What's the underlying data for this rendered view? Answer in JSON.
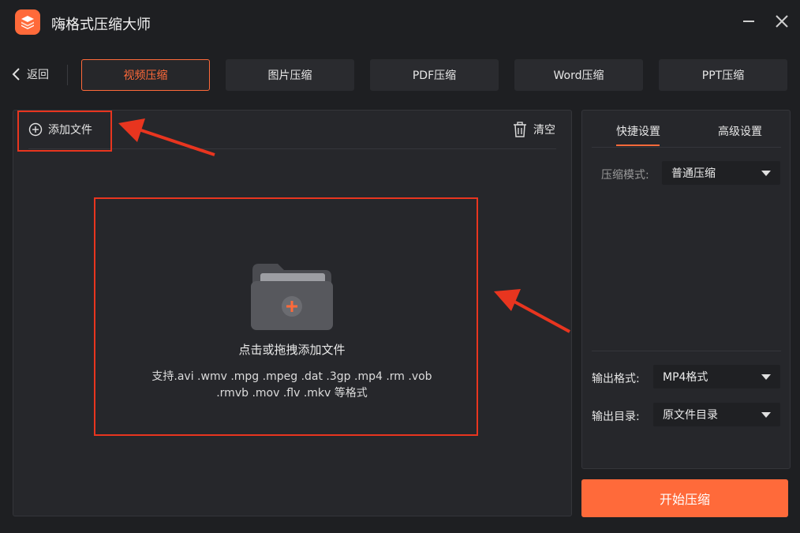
{
  "app": {
    "title": "嗨格式压缩大师",
    "accent": "#ff6a3a",
    "annotation_color": "#e8351f"
  },
  "nav": {
    "back_label": "返回",
    "tabs": [
      {
        "label": "视频压缩",
        "active": true
      },
      {
        "label": "图片压缩",
        "active": false
      },
      {
        "label": "PDF压缩",
        "active": false
      },
      {
        "label": "Word压缩",
        "active": false
      },
      {
        "label": "PPT压缩",
        "active": false
      }
    ]
  },
  "file_panel": {
    "add_file_label": "添加文件",
    "clear_label": "清空",
    "drop_hint": "点击或拖拽添加文件",
    "formats_line1": "支持.avi .wmv .mpg .mpeg .dat .3gp .mp4 .rm .vob",
    "formats_line2": ".rmvb .mov .flv .mkv 等格式"
  },
  "settings": {
    "tabs": [
      {
        "label": "快捷设置",
        "active": true
      },
      {
        "label": "高级设置",
        "active": false
      }
    ],
    "mode_label": "压缩模式:",
    "mode_value": "普通压缩",
    "output_format_label": "输出格式:",
    "output_format_value": "MP4格式",
    "output_dir_label": "输出目录:",
    "output_dir_value": "原文件目录"
  },
  "start_button": "开始压缩",
  "icons": [
    "app-logo-icon",
    "minimize-icon",
    "close-icon",
    "chevron-left-icon",
    "plus-circle-icon",
    "trash-icon",
    "folder-plus-icon",
    "caret-down-icon",
    "arrow-annotation"
  ]
}
